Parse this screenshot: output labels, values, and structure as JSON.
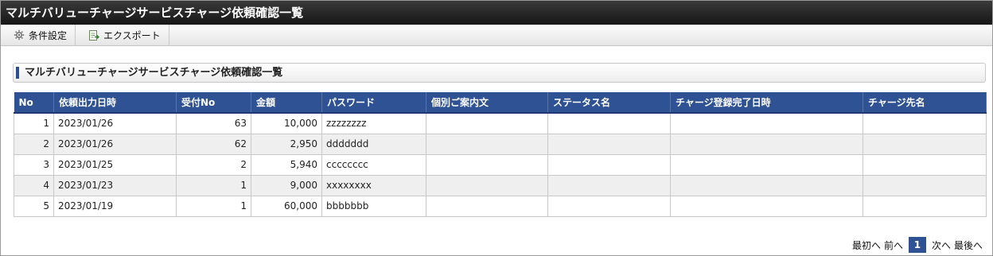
{
  "window": {
    "title": "マルチバリューチャージサービスチャージ依頼確認一覧"
  },
  "toolbar": {
    "conditions_label": "条件設定",
    "export_label": "エクスポート"
  },
  "section": {
    "title": "マルチバリューチャージサービスチャージ依頼確認一覧"
  },
  "table": {
    "columns": [
      "No",
      "依頼出力日時",
      "受付No",
      "金額",
      "パスワード",
      "個別ご案内文",
      "ステータス名",
      "チャージ登録完了日時",
      "チャージ先名"
    ],
    "rows": [
      [
        "1",
        "2023/01/26",
        "63",
        "10,000",
        "zzzzzzzz",
        "",
        "",
        "",
        ""
      ],
      [
        "2",
        "2023/01/26",
        "62",
        "2,950",
        "ddddddd",
        "",
        "",
        "",
        ""
      ],
      [
        "3",
        "2023/01/25",
        "2",
        "5,940",
        "cccccccc",
        "",
        "",
        "",
        ""
      ],
      [
        "4",
        "2023/01/23",
        "1",
        "9,000",
        "xxxxxxxx",
        "",
        "",
        "",
        ""
      ],
      [
        "5",
        "2023/01/19",
        "1",
        "60,000",
        "bbbbbbb",
        "",
        "",
        "",
        ""
      ]
    ]
  },
  "pager": {
    "first": "最初へ",
    "prev": "前へ",
    "current": "1",
    "next": "次へ",
    "last": "最後へ"
  },
  "colors": {
    "header_bg": "#2f5294",
    "title_bg": "#1f1f1f"
  },
  "icons": {
    "conditions": "gear-icon",
    "export": "export-icon"
  }
}
